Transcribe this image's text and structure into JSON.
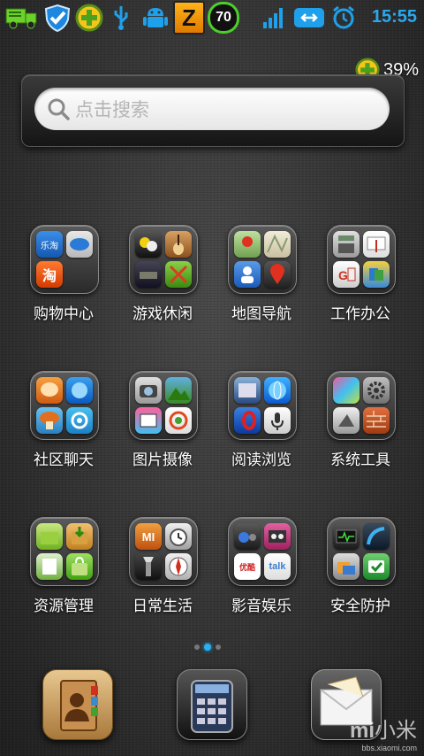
{
  "status_bar": {
    "time": "15:55",
    "badge_number": "70",
    "badge_letter": "Z",
    "icons": [
      "truck-icon",
      "shield-check-icon",
      "plus-circle-icon",
      "usb-icon",
      "android-icon",
      "z-app-icon",
      "badge-70-icon",
      "signal-icon",
      "sync-icon",
      "alarm-icon"
    ]
  },
  "battery": {
    "percent": "39%"
  },
  "search": {
    "placeholder": "点击搜索"
  },
  "folders": [
    {
      "label": "购物中心"
    },
    {
      "label": "游戏休闲"
    },
    {
      "label": "地图导航"
    },
    {
      "label": "工作办公"
    },
    {
      "label": "社区聊天"
    },
    {
      "label": "图片摄像"
    },
    {
      "label": "阅读浏览"
    },
    {
      "label": "系统工具"
    },
    {
      "label": "资源管理"
    },
    {
      "label": "日常生活"
    },
    {
      "label": "影音娱乐"
    },
    {
      "label": "安全防护"
    }
  ],
  "mini_icons": {
    "shop_1": "乐淘",
    "shop_3": "淘",
    "life_1": "MI",
    "media_2": "优酷",
    "media_3": "talk"
  },
  "pager": {
    "pages": 3,
    "current": 2
  },
  "dock": [
    "contacts-icon",
    "phone-dialer-icon",
    "messages-icon"
  ],
  "watermark": {
    "brand": "小米",
    "url": "bbs.xiaomi.com",
    "logo": "mi"
  },
  "colors": {
    "accent": "#2aa8ee",
    "label": "#ffffff"
  }
}
